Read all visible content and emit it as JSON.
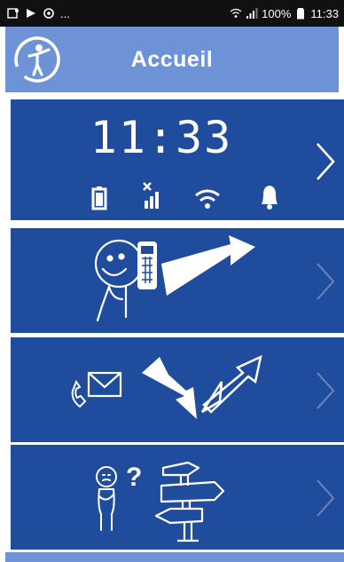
{
  "status_bar": {
    "battery": "100%",
    "time": "11:33",
    "notifications_overflow": "..."
  },
  "header": {
    "title": "Accueil",
    "logo_icon": "accessibility-person-icon"
  },
  "clock_panel": {
    "time": "11:33",
    "indicators": [
      "battery-icon",
      "no-signal-icon",
      "wifi-icon",
      "bell-icon"
    ]
  },
  "menu": [
    {
      "name": "call",
      "icon": "person-phone-arrow-icon"
    },
    {
      "name": "messages",
      "icon": "phone-envelope-arrows-icon"
    },
    {
      "name": "help",
      "icon": "confused-person-signpost-icon"
    }
  ],
  "colors": {
    "header": "#6d92d6",
    "panel": "#1f4c9d",
    "statusbar": "#111111",
    "foreground": "#ffffff"
  }
}
